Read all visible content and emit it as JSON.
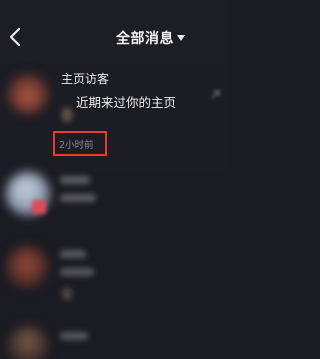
{
  "header": {
    "title": "全部消息",
    "back_icon": "chevron-left-icon",
    "dropdown_icon": "caret-down-icon"
  },
  "visitor_notice": {
    "title": "主页访客",
    "subtitle": "近期来过你的主页",
    "time": "2小时前",
    "highlight_color": "#e83a33"
  },
  "colors": {
    "background": "#1b1b23",
    "text": "#ffffff",
    "muted_text": "#8a8a91"
  }
}
